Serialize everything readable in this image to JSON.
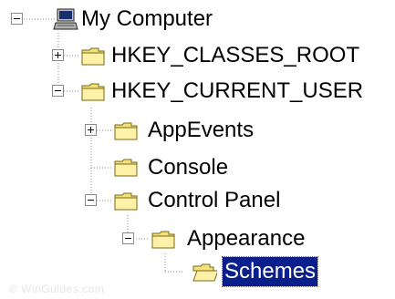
{
  "tree": {
    "root": {
      "label": "My Computer",
      "icon": "computer-icon",
      "expanded": true
    },
    "items": [
      {
        "label": "HKEY_CLASSES_ROOT",
        "icon": "folder-closed-icon",
        "expanded": false,
        "has_children": true
      },
      {
        "label": "HKEY_CURRENT_USER",
        "icon": "folder-closed-icon",
        "expanded": true,
        "has_children": true
      },
      {
        "label": "AppEvents",
        "icon": "folder-closed-icon",
        "expanded": false,
        "has_children": true
      },
      {
        "label": "Console",
        "icon": "folder-closed-icon",
        "expanded": false,
        "has_children": false
      },
      {
        "label": "Control Panel",
        "icon": "folder-closed-icon",
        "expanded": true,
        "has_children": true
      },
      {
        "label": "Appearance",
        "icon": "folder-closed-icon",
        "expanded": true,
        "has_children": true
      },
      {
        "label": "Schemes",
        "icon": "folder-open-icon",
        "expanded": false,
        "has_children": false,
        "selected": true
      }
    ]
  },
  "watermark": "© WinGuides.com",
  "colors": {
    "selection_bg": "#0a1f8c",
    "selection_text": "#ffffff",
    "folder_fill": "#f4e07a",
    "folder_edge": "#7a6a10",
    "guide_line": "#8a8a8a"
  }
}
